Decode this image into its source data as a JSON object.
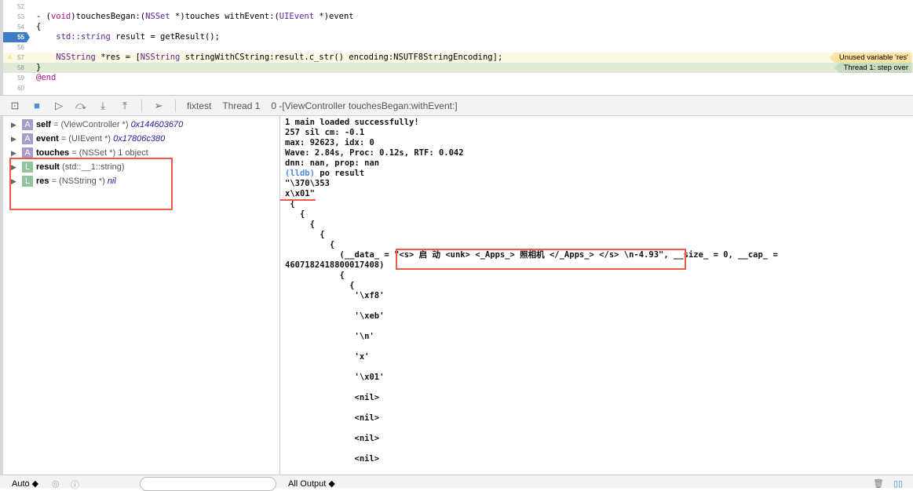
{
  "editor": {
    "lines": [
      {
        "n": "52",
        "code": ""
      },
      {
        "n": "53",
        "code": "- (void)touchesBegan:(NSSet *)touches withEvent:(UIEvent *)event"
      },
      {
        "n": "54",
        "code": "{"
      },
      {
        "n": "55",
        "code": "    std::string result = getResult();"
      },
      {
        "n": "56",
        "code": ""
      },
      {
        "n": "57",
        "code": "    NSString *res = [NSString stringWithCString:result.c_str() encoding:NSUTF8StringEncoding];"
      },
      {
        "n": "58",
        "code": "}"
      },
      {
        "n": "59",
        "code": "@end"
      },
      {
        "n": "60",
        "code": ""
      }
    ],
    "warning": "Unused variable 'res'",
    "step": "Thread 1: step over"
  },
  "toolbar": {
    "target": "fixtest",
    "thread": "Thread 1",
    "frame": "0 -[ViewController touchesBegan:withEvent:]"
  },
  "variables": [
    {
      "kind": "A",
      "name": "self",
      "type": " = (ViewController *) ",
      "value": "0x144603670"
    },
    {
      "kind": "A",
      "name": "event",
      "type": " = (UIEvent *) ",
      "value": "0x17806c380"
    },
    {
      "kind": "A",
      "name": "touches",
      "type": " = (NSSet *) 1 object",
      "value": ""
    },
    {
      "kind": "L",
      "name": "result",
      "type": " (std::__1::string)",
      "value": ""
    },
    {
      "kind": "L",
      "name": "res",
      "type": " = (NSString *) ",
      "value": "nil"
    }
  ],
  "console": {
    "head": "1 main loaded successfully!\n257 sil cm: -0.1\nmax: 92623, idx: 0\nWave: 2.84s, Proc: 0.12s, RTF: 0.042\ndnn: nan, prop: nan\n",
    "prompt": "(lldb)",
    "command": " po result",
    "body": "\n\"\\370\\353\nx\\x01\"\n {\n   {\n     {\n       {\n         {\n           (__data_ = \"<s> 启 动 <unk> <_Apps_> 照相机 </_Apps_> </s> \\n-4.93\", __size_ = 0, __cap_ =\n4607182418800017408)\n           {\n             {\n              '\\xf8'\n\n              '\\xeb'\n\n              '\\n'\n\n              'x'\n\n              '\\x01'\n\n              <nil>\n\n              <nil>\n\n              <nil>\n\n              <nil>"
  },
  "bottom": {
    "scope": "Auto ◆",
    "output": "All Output ◆"
  }
}
